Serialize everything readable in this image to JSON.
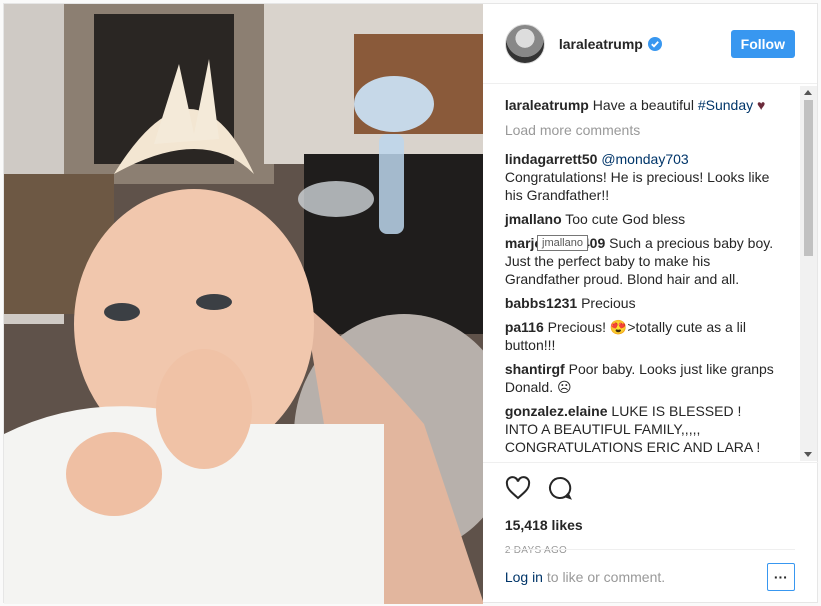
{
  "post": {
    "username": "laraleatrump",
    "follow_label": "Follow",
    "load_more": "Load more comments",
    "caption": {
      "user": "laraleatrump",
      "text": "Have a beautiful ",
      "hashtag": "#Sunday",
      "emoji": "♥"
    },
    "comments": [
      {
        "user": "lindagarrett50",
        "mention": "@monday703",
        "text": " Congratulations! He is precious! Looks like his Grandfather!!"
      },
      {
        "user": "jmallano",
        "text": "Too cute God bless"
      },
      {
        "user": "marjo_____409",
        "text": "Such a precious baby boy. Just the perfect baby to make his Grandfather proud. Blond hair and all."
      },
      {
        "user": "babbs1231",
        "text": "Precious"
      },
      {
        "user": "pa116",
        "text": "Precious! 😍>totally cute as a lil button!!!"
      },
      {
        "user": "shantirgf",
        "text": "Poor baby. Looks just like granps Donald. ☹"
      },
      {
        "user": "gonzalez.elaine",
        "text": "LUKE IS BLESSED ! INTO A BEAUTIFUL FAMILY,,,,, CONGRATULATIONS ERIC AND LARA !"
      }
    ],
    "tooltip": "jmallano",
    "likes": "15,418 likes",
    "time": "2 DAYS AGO",
    "login_link": "Log in",
    "login_text": " to like or comment.",
    "more_label": "···"
  },
  "colors": {
    "accent": "#3897f0",
    "link": "#003569",
    "muted": "#999999"
  },
  "icons": [
    "verified-badge-icon",
    "heart-icon",
    "comment-icon",
    "more-options-icon"
  ]
}
